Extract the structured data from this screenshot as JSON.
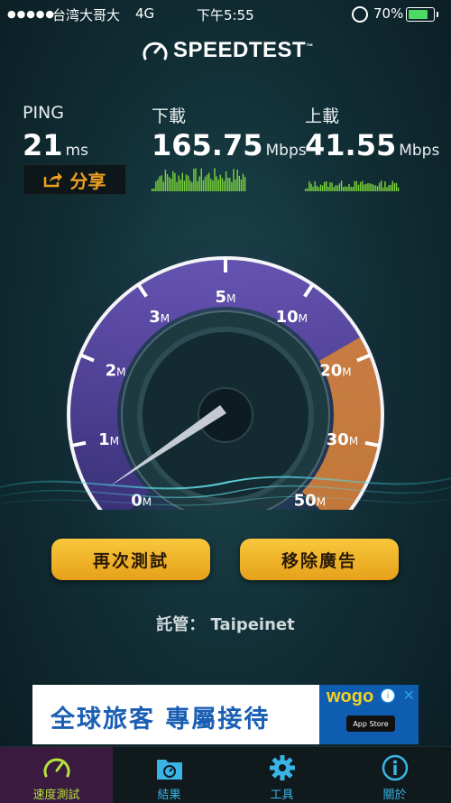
{
  "status": {
    "signal": "●●●●●",
    "carrier": "台湾大哥大",
    "network": "4G",
    "time": "下午5:55",
    "battery_pct": "70%",
    "battery_level": 0.7
  },
  "brand": {
    "name": "SPEEDTEST",
    "tm": "™"
  },
  "metrics": {
    "ping": {
      "label": "PING",
      "value": "21",
      "unit": "ms"
    },
    "download": {
      "label": "下載",
      "value": "165.75",
      "unit": "Mbps"
    },
    "upload": {
      "label": "上載",
      "value": "41.55",
      "unit": "Mbps"
    }
  },
  "share_label": "分享",
  "gauge": {
    "ticks": [
      {
        "num": "0",
        "unit": "M"
      },
      {
        "num": "1",
        "unit": "M"
      },
      {
        "num": "2",
        "unit": "M"
      },
      {
        "num": "3",
        "unit": "M"
      },
      {
        "num": "5",
        "unit": "M"
      },
      {
        "num": "10",
        "unit": "M"
      },
      {
        "num": "20",
        "unit": "M"
      },
      {
        "num": "30",
        "unit": "M"
      },
      {
        "num": "50",
        "unit": "M"
      }
    ],
    "needle_value": "0",
    "accent_color": "#e58a2a",
    "scale_color": "#6b4fb8"
  },
  "buttons": {
    "retest": "再次測試",
    "remove_ads": "移除廣告"
  },
  "host": {
    "label": "託管：",
    "value": "Taipeinet"
  },
  "ad": {
    "headline": "全球旅客  專屬接待",
    "logo": "wogo",
    "store": "App Store"
  },
  "tabs": [
    {
      "label": "速度測試",
      "icon": "speedometer-icon"
    },
    {
      "label": "結果",
      "icon": "folder-icon"
    },
    {
      "label": "工具",
      "icon": "gear-icon"
    },
    {
      "label": "關於",
      "icon": "info-icon"
    }
  ]
}
